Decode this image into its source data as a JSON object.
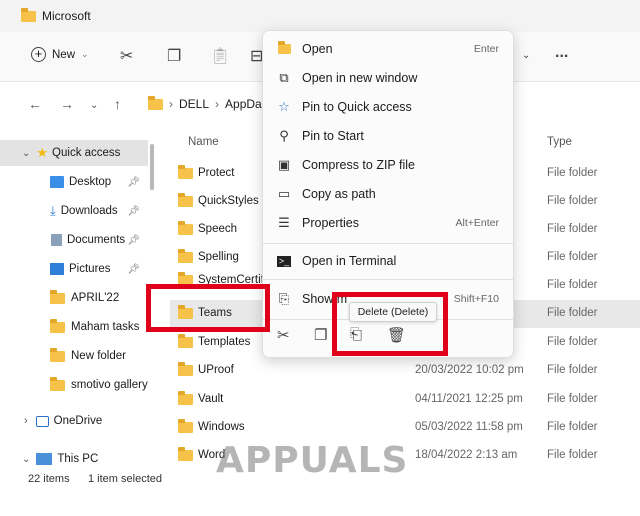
{
  "window": {
    "title": "Microsoft"
  },
  "toolbar": {
    "new_label": "New",
    "more": "..."
  },
  "address": {
    "path": [
      "DELL",
      "AppDat"
    ]
  },
  "sidebar": {
    "items": [
      {
        "label": "Quick access",
        "icon": "star-icon"
      },
      {
        "label": "Desktop",
        "icon": "desktop-icon",
        "pinned": true
      },
      {
        "label": "Downloads",
        "icon": "download-icon",
        "pinned": true
      },
      {
        "label": "Documents",
        "icon": "document-icon",
        "pinned": true
      },
      {
        "label": "Pictures",
        "icon": "picture-icon",
        "pinned": true
      },
      {
        "label": "APRIL'22",
        "icon": "folder-icon"
      },
      {
        "label": "Maham tasks",
        "icon": "folder-icon"
      },
      {
        "label": "New folder",
        "icon": "folder-icon"
      },
      {
        "label": "smotivo gallery",
        "icon": "folder-icon"
      },
      {
        "label": "OneDrive",
        "icon": "onedrive-icon"
      },
      {
        "label": "This PC",
        "icon": "pc-icon"
      }
    ]
  },
  "columns": {
    "name": "Name",
    "type": "Type"
  },
  "files": [
    {
      "name": "Protect",
      "date": "",
      "type": "File folder"
    },
    {
      "name": "QuickStyles",
      "date": "",
      "type": "File folder"
    },
    {
      "name": "Speech",
      "date": "",
      "type": "File folder"
    },
    {
      "name": "Spelling",
      "date": "",
      "type": "File folder"
    },
    {
      "name": "SystemCertific",
      "date": "",
      "type": "File folder"
    },
    {
      "name": "Teams",
      "date": "",
      "type": "File folder"
    },
    {
      "name": "Templates",
      "date": "",
      "type": "File folder"
    },
    {
      "name": "UProof",
      "date": "20/03/2022 10:02 pm",
      "type": "File folder"
    },
    {
      "name": "Vault",
      "date": "04/11/2021 12:25 pm",
      "type": "File folder"
    },
    {
      "name": "Windows",
      "date": "05/03/2022 11:58 pm",
      "type": "File folder"
    },
    {
      "name": "Word",
      "date": "18/04/2022 2:13 am",
      "type": "File folder"
    }
  ],
  "status": {
    "count": "22 items",
    "selected": "1 item selected"
  },
  "context_menu": {
    "items": [
      {
        "label": "Open",
        "shortcut": "Enter",
        "icon": "folder-open-icon"
      },
      {
        "label": "Open in new window",
        "shortcut": "",
        "icon": "new-window-icon"
      },
      {
        "label": "Pin to Quick access",
        "shortcut": "",
        "icon": "star-outline-icon"
      },
      {
        "label": "Pin to Start",
        "shortcut": "",
        "icon": "pin-icon"
      },
      {
        "label": "Compress to ZIP file",
        "shortcut": "",
        "icon": "zip-icon"
      },
      {
        "label": "Copy as path",
        "shortcut": "",
        "icon": "copy-path-icon"
      },
      {
        "label": "Properties",
        "shortcut": "Alt+Enter",
        "icon": "properties-icon"
      },
      {
        "label": "Open in Terminal",
        "shortcut": "",
        "icon": "terminal-icon"
      },
      {
        "label": "Show m",
        "shortcut": "Shift+F10",
        "icon": "more-options-icon"
      }
    ],
    "tooltip": "Delete (Delete)"
  },
  "watermark": "APPUALS",
  "colors": {
    "highlight": "#e0001a",
    "folder": "#f6c24a"
  }
}
